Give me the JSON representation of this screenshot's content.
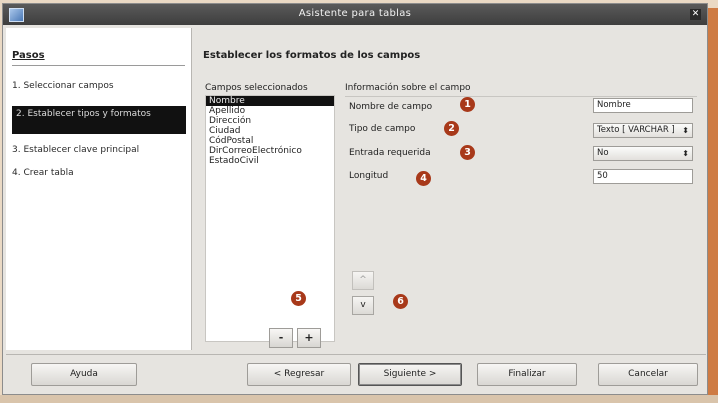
{
  "window": {
    "title": "Asistente para tablas"
  },
  "steps": {
    "title": "Pasos",
    "items": [
      {
        "label": "1. Seleccionar campos"
      },
      {
        "label": "2. Establecer tipos y formatos"
      },
      {
        "label": "3. Establecer clave principal"
      },
      {
        "label": "4. Crear tabla"
      }
    ],
    "active_index": 1
  },
  "main": {
    "section_title": "Establecer los formatos de los campos",
    "fields_label": "Campos seleccionados",
    "fields": [
      "Nombre",
      "Apellido",
      "Dirección",
      "Ciudad",
      "CódPostal",
      "DirCorreoElectrónico",
      "EstadoCivil"
    ],
    "selected_field": "Nombre",
    "info_label": "Información sobre el campo",
    "properties": [
      {
        "label": "Nombre de campo",
        "value": "Nombre"
      },
      {
        "label": "Tipo de campo",
        "value": "Texto [ VARCHAR ]"
      },
      {
        "label": "Entrada requerida",
        "value": "No"
      },
      {
        "label": "Longitud",
        "value": "50"
      }
    ],
    "move_up": "^",
    "move_down": "v",
    "remove": "-",
    "add": "+"
  },
  "badges": [
    "1",
    "2",
    "3",
    "4",
    "5",
    "6"
  ],
  "buttons": {
    "help": "Ayuda",
    "back": "< Regresar",
    "next": "Siguiente >",
    "finish": "Finalizar",
    "cancel": "Cancelar"
  },
  "colors": {
    "badge": "#a8391a",
    "selection": "#111111",
    "titlebar": "#4a4a4a"
  }
}
